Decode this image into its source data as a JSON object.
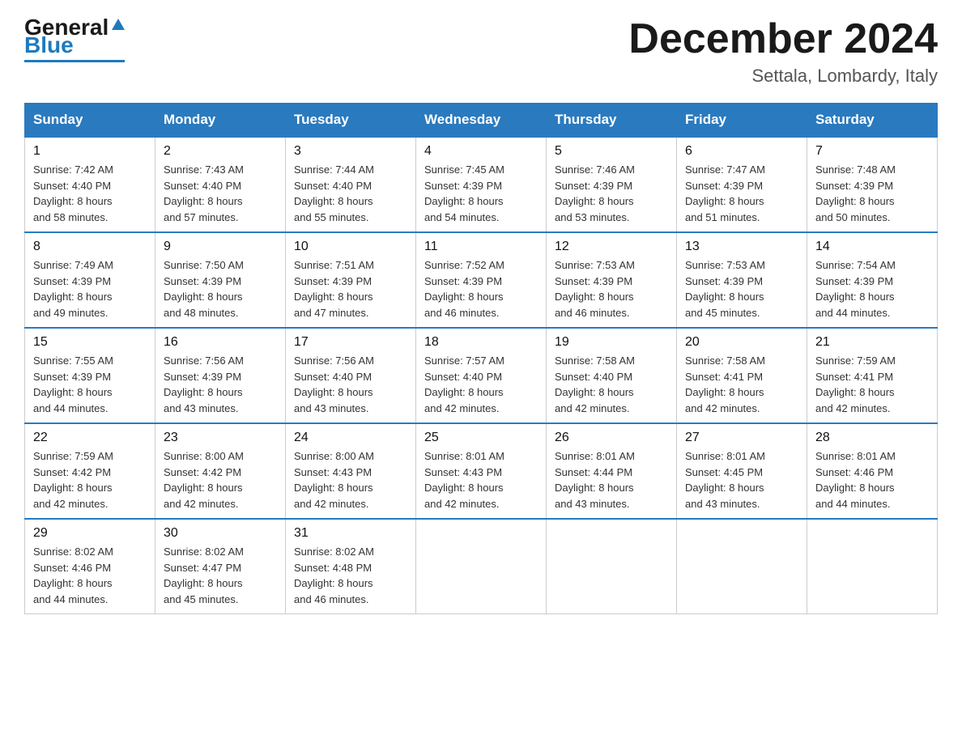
{
  "header": {
    "logo_general": "General",
    "logo_blue": "Blue",
    "month_title": "December 2024",
    "location": "Settala, Lombardy, Italy"
  },
  "days_of_week": [
    "Sunday",
    "Monday",
    "Tuesday",
    "Wednesday",
    "Thursday",
    "Friday",
    "Saturday"
  ],
  "weeks": [
    [
      {
        "day": "1",
        "sunrise": "7:42 AM",
        "sunset": "4:40 PM",
        "daylight": "8 hours and 58 minutes."
      },
      {
        "day": "2",
        "sunrise": "7:43 AM",
        "sunset": "4:40 PM",
        "daylight": "8 hours and 57 minutes."
      },
      {
        "day": "3",
        "sunrise": "7:44 AM",
        "sunset": "4:40 PM",
        "daylight": "8 hours and 55 minutes."
      },
      {
        "day": "4",
        "sunrise": "7:45 AM",
        "sunset": "4:39 PM",
        "daylight": "8 hours and 54 minutes."
      },
      {
        "day": "5",
        "sunrise": "7:46 AM",
        "sunset": "4:39 PM",
        "daylight": "8 hours and 53 minutes."
      },
      {
        "day": "6",
        "sunrise": "7:47 AM",
        "sunset": "4:39 PM",
        "daylight": "8 hours and 51 minutes."
      },
      {
        "day": "7",
        "sunrise": "7:48 AM",
        "sunset": "4:39 PM",
        "daylight": "8 hours and 50 minutes."
      }
    ],
    [
      {
        "day": "8",
        "sunrise": "7:49 AM",
        "sunset": "4:39 PM",
        "daylight": "8 hours and 49 minutes."
      },
      {
        "day": "9",
        "sunrise": "7:50 AM",
        "sunset": "4:39 PM",
        "daylight": "8 hours and 48 minutes."
      },
      {
        "day": "10",
        "sunrise": "7:51 AM",
        "sunset": "4:39 PM",
        "daylight": "8 hours and 47 minutes."
      },
      {
        "day": "11",
        "sunrise": "7:52 AM",
        "sunset": "4:39 PM",
        "daylight": "8 hours and 46 minutes."
      },
      {
        "day": "12",
        "sunrise": "7:53 AM",
        "sunset": "4:39 PM",
        "daylight": "8 hours and 46 minutes."
      },
      {
        "day": "13",
        "sunrise": "7:53 AM",
        "sunset": "4:39 PM",
        "daylight": "8 hours and 45 minutes."
      },
      {
        "day": "14",
        "sunrise": "7:54 AM",
        "sunset": "4:39 PM",
        "daylight": "8 hours and 44 minutes."
      }
    ],
    [
      {
        "day": "15",
        "sunrise": "7:55 AM",
        "sunset": "4:39 PM",
        "daylight": "8 hours and 44 minutes."
      },
      {
        "day": "16",
        "sunrise": "7:56 AM",
        "sunset": "4:39 PM",
        "daylight": "8 hours and 43 minutes."
      },
      {
        "day": "17",
        "sunrise": "7:56 AM",
        "sunset": "4:40 PM",
        "daylight": "8 hours and 43 minutes."
      },
      {
        "day": "18",
        "sunrise": "7:57 AM",
        "sunset": "4:40 PM",
        "daylight": "8 hours and 42 minutes."
      },
      {
        "day": "19",
        "sunrise": "7:58 AM",
        "sunset": "4:40 PM",
        "daylight": "8 hours and 42 minutes."
      },
      {
        "day": "20",
        "sunrise": "7:58 AM",
        "sunset": "4:41 PM",
        "daylight": "8 hours and 42 minutes."
      },
      {
        "day": "21",
        "sunrise": "7:59 AM",
        "sunset": "4:41 PM",
        "daylight": "8 hours and 42 minutes."
      }
    ],
    [
      {
        "day": "22",
        "sunrise": "7:59 AM",
        "sunset": "4:42 PM",
        "daylight": "8 hours and 42 minutes."
      },
      {
        "day": "23",
        "sunrise": "8:00 AM",
        "sunset": "4:42 PM",
        "daylight": "8 hours and 42 minutes."
      },
      {
        "day": "24",
        "sunrise": "8:00 AM",
        "sunset": "4:43 PM",
        "daylight": "8 hours and 42 minutes."
      },
      {
        "day": "25",
        "sunrise": "8:01 AM",
        "sunset": "4:43 PM",
        "daylight": "8 hours and 42 minutes."
      },
      {
        "day": "26",
        "sunrise": "8:01 AM",
        "sunset": "4:44 PM",
        "daylight": "8 hours and 43 minutes."
      },
      {
        "day": "27",
        "sunrise": "8:01 AM",
        "sunset": "4:45 PM",
        "daylight": "8 hours and 43 minutes."
      },
      {
        "day": "28",
        "sunrise": "8:01 AM",
        "sunset": "4:46 PM",
        "daylight": "8 hours and 44 minutes."
      }
    ],
    [
      {
        "day": "29",
        "sunrise": "8:02 AM",
        "sunset": "4:46 PM",
        "daylight": "8 hours and 44 minutes."
      },
      {
        "day": "30",
        "sunrise": "8:02 AM",
        "sunset": "4:47 PM",
        "daylight": "8 hours and 45 minutes."
      },
      {
        "day": "31",
        "sunrise": "8:02 AM",
        "sunset": "4:48 PM",
        "daylight": "8 hours and 46 minutes."
      },
      null,
      null,
      null,
      null
    ]
  ],
  "labels": {
    "sunrise": "Sunrise:",
    "sunset": "Sunset:",
    "daylight": "Daylight:"
  }
}
